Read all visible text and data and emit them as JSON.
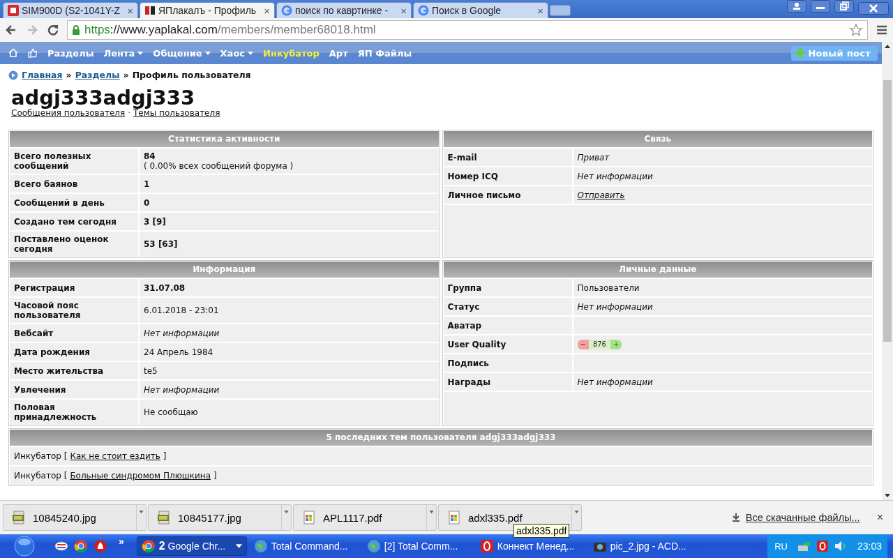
{
  "browser": {
    "tabs": [
      {
        "title": "SIM900D (S2-1041Y-Z",
        "selected": false
      },
      {
        "title": "ЯПлакалъ - Профиль",
        "selected": true
      },
      {
        "title": "поиск по кавртинке -",
        "selected": false
      },
      {
        "title": "Поиск в Google",
        "selected": false
      }
    ],
    "tab_close": "×",
    "url": {
      "scheme": "https",
      "host": "://www.yaplakal.com",
      "path": "/members/member68018.html"
    }
  },
  "nav": {
    "items": [
      {
        "label": "Разделы",
        "dropdown": false,
        "highlighted": false
      },
      {
        "label": "Лента",
        "dropdown": true,
        "highlighted": false
      },
      {
        "label": "Общение",
        "dropdown": true,
        "highlighted": false
      },
      {
        "label": "Хаос",
        "dropdown": true,
        "highlighted": false
      },
      {
        "label": "Инкубатор",
        "dropdown": false,
        "highlighted": true
      },
      {
        "label": "Арт",
        "dropdown": false,
        "highlighted": false
      },
      {
        "label": "ЯП Файлы",
        "dropdown": false,
        "highlighted": false
      }
    ],
    "new_post": "Новый пост"
  },
  "breadcrumb": {
    "links": [
      "Главная",
      "Разделы"
    ],
    "separator": "»",
    "current": "Профиль пользователя"
  },
  "profile": {
    "username": "adgj333adgj333",
    "links": [
      "Сообщения пользователя",
      "Темы пользователя"
    ],
    "link_separator": "·"
  },
  "panels": [
    {
      "title": "Статистика активности",
      "rows": [
        {
          "label": "Всего полезных сообщений",
          "value": "84",
          "note": "( 0.00% всех сообщений форума )",
          "kind": "bold"
        },
        {
          "label": "Всего баянов",
          "value": "1",
          "kind": "bold"
        },
        {
          "label": "Сообщений в день",
          "value": "0",
          "kind": "bold"
        },
        {
          "label": "Создано тем сегодня",
          "value": "3 [9]",
          "kind": "bold"
        },
        {
          "label": "Поставлено оценок сегодня",
          "value": "53 [63]",
          "kind": "bold"
        }
      ]
    },
    {
      "title": "Связь",
      "rows": [
        {
          "label": "E-mail",
          "value": "Приват",
          "kind": "italic"
        },
        {
          "label": "Номер ICQ",
          "value": "Нет информации",
          "kind": "italic"
        },
        {
          "label": "Личное письмо",
          "value": "Отправить",
          "kind": "link"
        }
      ]
    },
    {
      "title": "Информация",
      "rows": [
        {
          "label": "Регистрация",
          "value": "31.07.08",
          "kind": "bold"
        },
        {
          "label": "Часовой пояс пользователя",
          "value": "6.01.2018 - 23:01",
          "kind": "text"
        },
        {
          "label": "Вебсайт",
          "value": "Нет информации",
          "kind": "italic"
        },
        {
          "label": "Дата рождения",
          "value": "24 Апрель 1984",
          "kind": "text"
        },
        {
          "label": "Место жительства",
          "value": "te5",
          "kind": "text"
        },
        {
          "label": "Увлечения",
          "value": "Нет информации",
          "kind": "italic"
        },
        {
          "label": "Половая принадлежность",
          "value": "Не сообщаю",
          "kind": "text"
        }
      ]
    },
    {
      "title": "Личные данные",
      "rows": [
        {
          "label": "Группа",
          "value": "Пользователи",
          "kind": "text"
        },
        {
          "label": "Статус",
          "value": "Нет информации",
          "kind": "italic"
        },
        {
          "label": "Аватар",
          "kind": "empty"
        },
        {
          "label": "User Quality",
          "value": "876",
          "minus": "−",
          "plus": "+",
          "kind": "rating"
        },
        {
          "label": "Подпись",
          "kind": "empty"
        },
        {
          "label": "Награды",
          "value": "Нет информации",
          "kind": "italic"
        }
      ]
    }
  ],
  "recent_topics": {
    "title": "5 последних тем пользователя adgj333adgj333",
    "rows": [
      {
        "prefix": "Инкубатор [",
        "topic": "Как не стоит ездить",
        "suffix": "]"
      },
      {
        "prefix": "Инкубатор [",
        "topic": "Больные синдромом Плюшкина",
        "suffix": "]"
      }
    ]
  },
  "downloads": {
    "items": [
      {
        "name": "10845240.jpg",
        "kind": "jpg"
      },
      {
        "name": "10845177.jpg",
        "kind": "jpg"
      },
      {
        "name": "APL1117.pdf",
        "kind": "pdf"
      },
      {
        "name": "adxl335.pdf",
        "kind": "pdf"
      }
    ],
    "tooltip": "adxl335.pdf",
    "all_link": "Все скачанные файлы...",
    "close": "×"
  },
  "taskbar": {
    "buttons": [
      {
        "count": "2",
        "label": "Google Chr...",
        "selected": true
      },
      {
        "label": "Total Command...",
        "selected": false
      },
      {
        "label": "[2] Total Comm...",
        "selected": false
      },
      {
        "label": "Коннект Менед...",
        "selected": false
      },
      {
        "label": "pic_2.jpg - ACD...",
        "selected": false
      }
    ],
    "more": "»",
    "language": "RU",
    "clock": "23:03"
  }
}
